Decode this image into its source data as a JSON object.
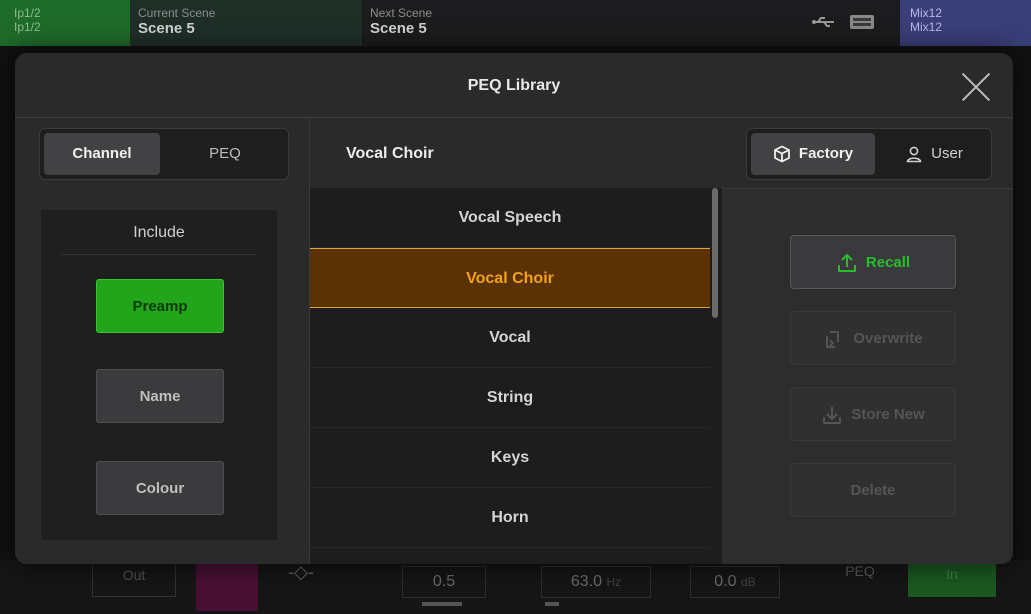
{
  "topbar": {
    "ip_line1": "Ip1/2",
    "ip_line2": "Ip1/2",
    "current_label": "Current Scene",
    "current_value": "Scene 5",
    "next_label": "Next Scene",
    "next_value": "Scene 5",
    "mix_line1": "Mix12",
    "mix_line2": "Mix12"
  },
  "bottombar": {
    "out_label": "Out",
    "q_value": "0.5",
    "freq_value": "63.0",
    "freq_unit": "Hz",
    "gain_value": "0.0",
    "gain_unit": "dB",
    "peq_label": "PEQ",
    "in_label": "In"
  },
  "modal": {
    "title": "PEQ Library",
    "mode_tabs": [
      {
        "label": "Channel",
        "selected": true
      },
      {
        "label": "PEQ",
        "selected": false
      }
    ],
    "include": {
      "title": "Include",
      "options": [
        {
          "label": "Preamp",
          "active": true
        },
        {
          "label": "Name",
          "active": false
        },
        {
          "label": "Colour",
          "active": false
        }
      ]
    },
    "selected_preset": "Vocal Choir",
    "presets": [
      "Vocal Speech",
      "Vocal Choir",
      "Vocal",
      "String",
      "Keys",
      "Horn"
    ],
    "library_tabs": [
      {
        "label": "Factory",
        "icon": "cube-icon",
        "selected": true
      },
      {
        "label": "User",
        "icon": "user-icon",
        "selected": false
      }
    ],
    "actions": {
      "recall": "Recall",
      "overwrite": "Overwrite",
      "store_new": "Store New",
      "delete": "Delete"
    }
  },
  "colors": {
    "accent_green": "#22a51b",
    "selection_orange": "#f3a21c",
    "selection_bg": "#5a3206"
  }
}
